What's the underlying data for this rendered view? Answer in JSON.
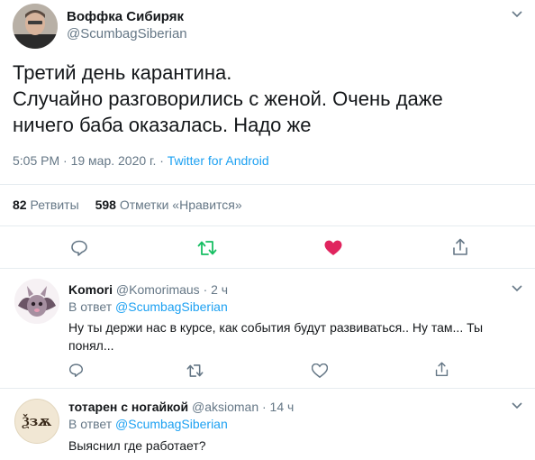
{
  "main_tweet": {
    "author_name": "Воффка Сибиряк",
    "author_handle": "@ScumbagSiberian",
    "text_line1": "Третий день карантина.",
    "text_line2": "Случайно разговорились с женой. Очень даже",
    "text_line3": "ничего баба оказалась. Надо же",
    "time": "5:05 PM · 19 мар. 2020 г. · ",
    "source": "Twitter for Android",
    "retweets_count": "82",
    "retweets_label": "Ретвиты",
    "likes_count": "598",
    "likes_label": "Отметки «Нравится»",
    "liked": true
  },
  "replies": [
    {
      "author_name": "Komori",
      "author_handle": "@Komorimaus · 2 ч",
      "reply_to_prefix": "В ответ ",
      "reply_to_handle": "@ScumbagSiberian",
      "text_line1": "Ну ты держи нас в курсе,  как события будут развиваться.. Ну там... Ты",
      "text_line2": "понял..."
    },
    {
      "author_name": "тотарен с ногайкой",
      "author_handle": "@aksioman · 14 ч",
      "reply_to_prefix": "В ответ ",
      "reply_to_handle": "@ScumbagSiberian",
      "text_line1": "Выяснил где работает?",
      "avatar_text": "Ѯзѫ"
    }
  ],
  "icons": {
    "reply": "reply-icon",
    "retweet": "retweet-icon",
    "like": "heart-icon",
    "share": "share-icon",
    "menu": "chevron-down-icon"
  },
  "colors": {
    "accent": "#1da1f2",
    "retweet": "#17bf63",
    "like": "#e0245e",
    "muted": "#657786"
  }
}
